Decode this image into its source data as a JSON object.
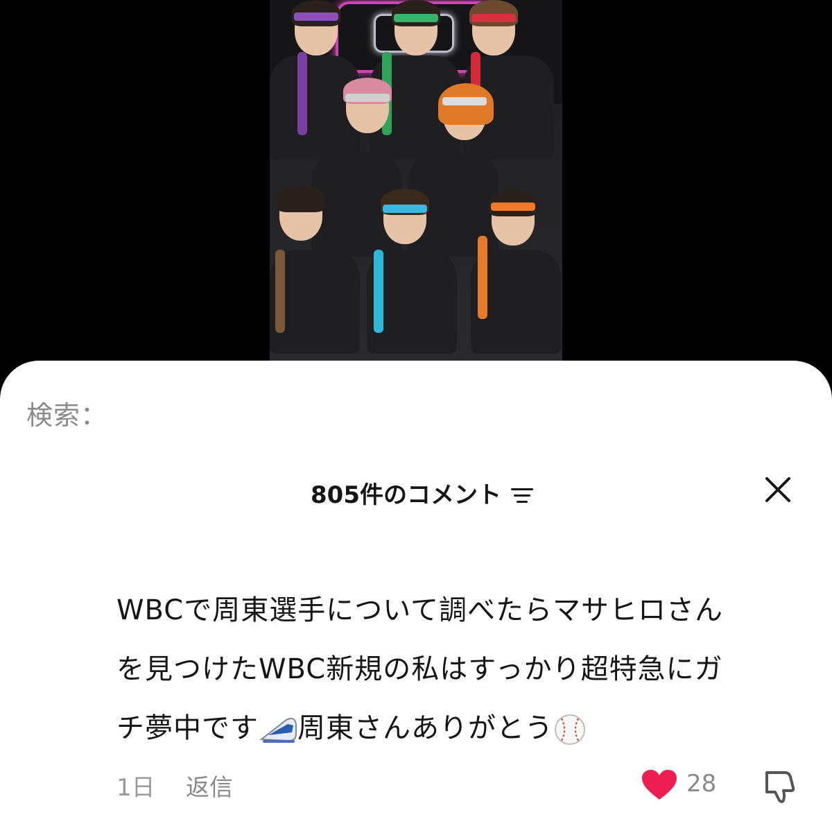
{
  "search": {
    "label": "検索："
  },
  "comments_header": {
    "title": "805件のコメント"
  },
  "comment": {
    "line1": "WBCで周東選手について調べたらマサヒロさん",
    "line2": "を見つけたWBC新規の私はすっかり超特急にガ",
    "line3_a": "チ夢中です",
    "line3_b": "周東さんありがとう",
    "time": "1日",
    "reply_label": "返信",
    "like_count": "28"
  },
  "colors": {
    "like_heart": "#ee1d52",
    "sheet_bg": "#ffffff",
    "page_bg": "#000000"
  },
  "icons": {
    "filter": "filter-lines-icon",
    "close": "close-icon",
    "like": "heart-icon",
    "dislike": "thumbs-down-icon",
    "train_emoji": "bullet-train-emoji",
    "baseball_emoji": "baseball-emoji"
  }
}
